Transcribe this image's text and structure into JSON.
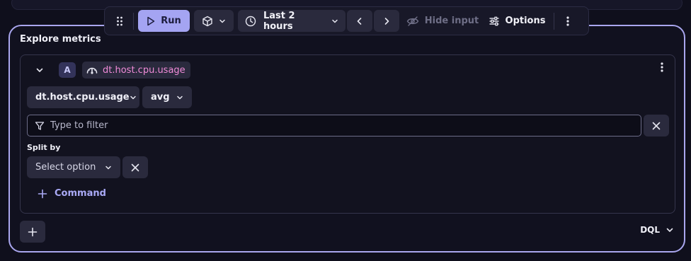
{
  "toolbar": {
    "run_label": "Run",
    "timeframe_label": "Last 2 hours",
    "hide_input_label": "Hide input",
    "options_label": "Options"
  },
  "panel": {
    "title": "Explore metrics"
  },
  "query": {
    "letter": "A",
    "metric_key": "dt.host.cpu.usage",
    "metric_select_value": "dt.host.cpu.usage",
    "aggregation_value": "avg",
    "filter_placeholder": "Type to filter",
    "split_by_label": "Split by",
    "split_by_value": "Select option",
    "command_label": "Command"
  },
  "footer": {
    "mode_label": "DQL"
  },
  "colors": {
    "accent": "#a9a6ee",
    "run_button": "#a4a4f2",
    "metric_text": "#f08bd8",
    "command_text": "#aaaaf6"
  },
  "icons": {
    "grip": "drag-grip-icon",
    "run": "play-icon",
    "cube": "cube-icon",
    "time": "clock-icon",
    "hide": "eye-off-icon",
    "options": "sliders-icon",
    "more": "more-vertical-icon",
    "metric": "gauge-icon",
    "filter": "filter-icon",
    "close": "close-icon",
    "add": "plus-icon"
  }
}
